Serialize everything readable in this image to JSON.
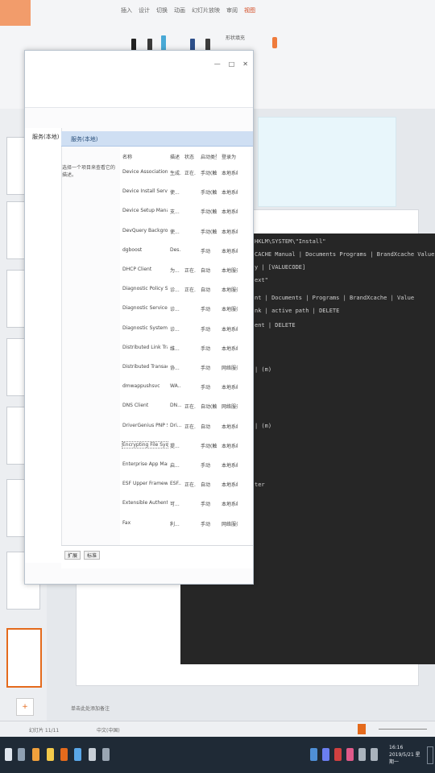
{
  "ribbon": {
    "tabs": [
      "插入",
      "设计",
      "切换",
      "动画",
      "幻灯片放映",
      "审阅",
      "视图"
    ],
    "active_tab": "视图",
    "right_label": "形状填充"
  },
  "services_window": {
    "tree_label": "服务(本地)",
    "header": "服务(本地)",
    "description": "选择一个项目来查看它的描述。",
    "columns": [
      "名称",
      "描述",
      "状态",
      "启动类型",
      "登录为"
    ],
    "rows": [
      {
        "name": "Device Association Service",
        "desc": "生成...",
        "status": "正在...",
        "start": "手动(触发...",
        "logon": "本地系统"
      },
      {
        "name": "Device Install Service",
        "desc": "使...",
        "status": "",
        "start": "手动(触发...",
        "logon": "本地系统"
      },
      {
        "name": "Device Setup Manager",
        "desc": "支...",
        "status": "",
        "start": "手动(触发...",
        "logon": "本地系统"
      },
      {
        "name": "DevQuery Background D...",
        "desc": "使...",
        "status": "",
        "start": "手动(触发...",
        "logon": "本地系统"
      },
      {
        "name": "dgboost",
        "desc": "Des...",
        "status": "",
        "start": "手动",
        "logon": "本地系统"
      },
      {
        "name": "DHCP Client",
        "desc": "为...",
        "status": "正在...",
        "start": "自动",
        "logon": "本地服务"
      },
      {
        "name": "Diagnostic Policy Service",
        "desc": "诊...",
        "status": "正在...",
        "start": "自动",
        "logon": "本地服务"
      },
      {
        "name": "Diagnostic Service Host",
        "desc": "诊...",
        "status": "",
        "start": "手动",
        "logon": "本地服务"
      },
      {
        "name": "Diagnostic System Host",
        "desc": "诊...",
        "status": "",
        "start": "手动",
        "logon": "本地系统"
      },
      {
        "name": "Distributed Link Tracking...",
        "desc": "维...",
        "status": "",
        "start": "手动",
        "logon": "本地系统"
      },
      {
        "name": "Distributed Transaction C...",
        "desc": "协...",
        "status": "",
        "start": "手动",
        "logon": "网络服务"
      },
      {
        "name": "dmwappushsvc",
        "desc": "WA...",
        "status": "",
        "start": "手动",
        "logon": "本地系统"
      },
      {
        "name": "DNS Client",
        "desc": "DN...",
        "status": "正在...",
        "start": "自动(触发...",
        "logon": "网络服务"
      },
      {
        "name": "DriverGenius PNP Service",
        "desc": "Dri...",
        "status": "正在...",
        "start": "自动",
        "logon": "本地系统"
      },
      {
        "name": "Encrypting File System (E...",
        "desc": "提...",
        "status": "",
        "start": "手动(触发...",
        "logon": "本地系统"
      },
      {
        "name": "Enterprise App Manage...",
        "desc": "启...",
        "status": "",
        "start": "手动",
        "logon": "本地系统"
      },
      {
        "name": "ESF Upper Framework S...",
        "desc": "ESF...",
        "status": "正在...",
        "start": "自动",
        "logon": "本地系统"
      },
      {
        "name": "Extensible Authenticatio...",
        "desc": "可...",
        "status": "",
        "start": "手动",
        "logon": "本地系统"
      },
      {
        "name": "Fax",
        "desc": "利...",
        "status": "",
        "start": "手动",
        "logon": "网络服务"
      }
    ],
    "selected_row": 14,
    "tabs": [
      "扩展",
      "标准"
    ]
  },
  "console": {
    "lines": [
      "HKLM\\SYSTEM\\\"Install\"",
      "CACHE Manual | Documents Programs | BrandXcache Value",
      "y | [VALUECODE]",
      "ext\"",
      "nt | Documents | Programs | BrandXcache | Value",
      "nk | active path | DELETE",
      "ent | DELETE",
      "| (m)",
      "| (m)",
      "ter"
    ]
  },
  "slide_notes": "单击此处添加备注",
  "status_bar": {
    "left": "幻灯片 11/11",
    "lang": "中文(中国)"
  },
  "taskbar": {
    "time": "16:16",
    "date": "2019/5/21 星期一"
  },
  "colors": {
    "accent_orange": "#e46a1c",
    "selection_blue": "#cfdff3",
    "console_bg": "#262626",
    "taskbar_bg": "#1f2a36"
  }
}
